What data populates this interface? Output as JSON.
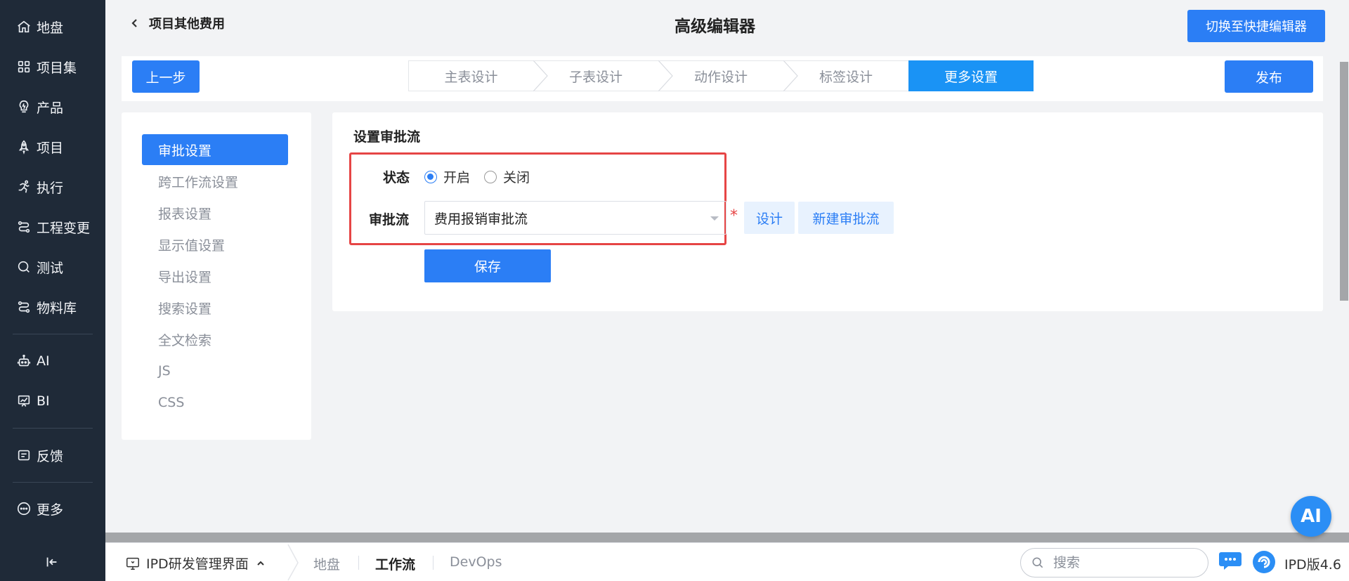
{
  "sidebar": {
    "items": [
      {
        "label": "地盘",
        "icon": "home-icon"
      },
      {
        "label": "项目集",
        "icon": "grid-icon"
      },
      {
        "label": "产品",
        "icon": "lightbulb-icon"
      },
      {
        "label": "项目",
        "icon": "rocket-icon"
      },
      {
        "label": "执行",
        "icon": "run-icon"
      },
      {
        "label": "工程变更",
        "icon": "flow-icon"
      },
      {
        "label": "测试",
        "icon": "search-circle-icon"
      },
      {
        "label": "物料库",
        "icon": "flow-icon"
      },
      {
        "label": "AI",
        "icon": "robot-icon"
      },
      {
        "label": "BI",
        "icon": "chart-board-icon"
      },
      {
        "label": "反馈",
        "icon": "feedback-icon"
      },
      {
        "label": "更多",
        "icon": "more-circle-icon"
      }
    ]
  },
  "header": {
    "back_title": "项目其他费用",
    "editor_title": "高级编辑器",
    "switch_label": "切换至快捷编辑器"
  },
  "stepbar": {
    "prev_label": "上一步",
    "publish_label": "发布",
    "steps": [
      "主表设计",
      "子表设计",
      "动作设计",
      "标签设计",
      "更多设置"
    ],
    "active_step": "更多设置"
  },
  "settings_menu": {
    "items": [
      "审批设置",
      "跨工作流设置",
      "报表设置",
      "显示值设置",
      "导出设置",
      "搜索设置",
      "全文检索",
      "JS",
      "CSS"
    ],
    "active": "审批设置"
  },
  "panel": {
    "title": "设置审批流",
    "status_label": "状态",
    "status_options": [
      "开启",
      "关闭"
    ],
    "status_selected": "开启",
    "flow_label": "审批流",
    "flow_value": "费用报销审批流",
    "required_mark": "*",
    "design_label": "设计",
    "new_flow_label": "新建审批流",
    "save_label": "保存"
  },
  "ai_button": "AI",
  "bottombar": {
    "app_name": "IPD研发管理界面",
    "links": [
      "地盘",
      "工作流",
      "DevOps"
    ],
    "active_link": "工作流",
    "search_placeholder": "搜索",
    "version": "IPD版4.6"
  },
  "colors": {
    "primary": "#2b7ef5",
    "step_active": "#1a93f5",
    "sidebar_bg": "#1f2a38",
    "highlight_border": "#e64545"
  }
}
